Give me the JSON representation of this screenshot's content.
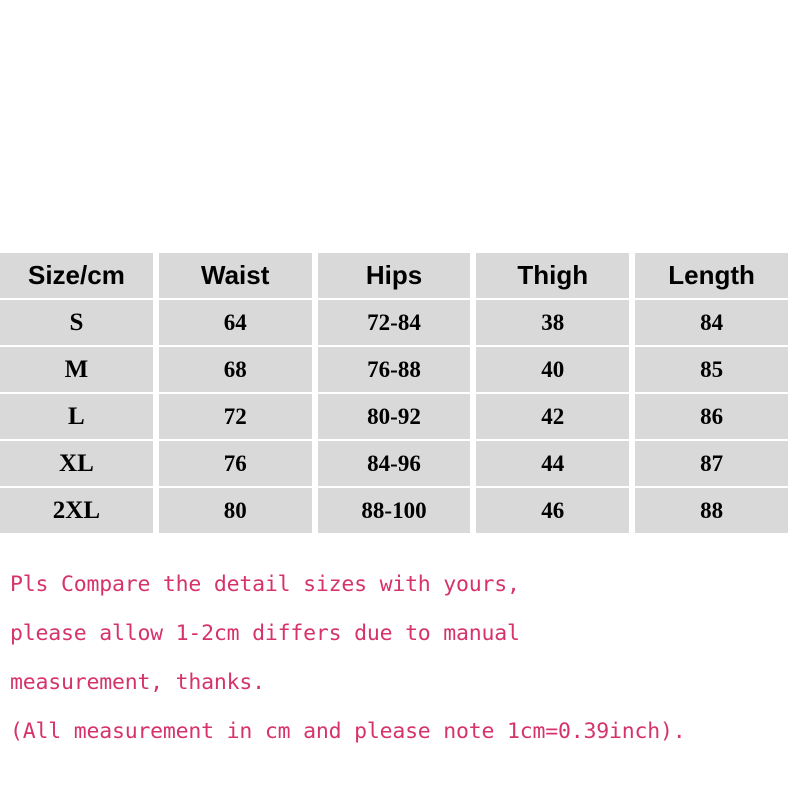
{
  "table": {
    "headers": [
      "Size/cm",
      "Waist",
      "Hips",
      "Thigh",
      "Length"
    ],
    "rows": [
      {
        "size": "S",
        "waist": "64",
        "hips": "72-84",
        "thigh": "38",
        "length": "84"
      },
      {
        "size": "M",
        "waist": "68",
        "hips": "76-88",
        "thigh": "40",
        "length": "85"
      },
      {
        "size": "L",
        "waist": "72",
        "hips": "80-92",
        "thigh": "42",
        "length": "86"
      },
      {
        "size": "XL",
        "waist": "76",
        "hips": "84-96",
        "thigh": "44",
        "length": "87"
      },
      {
        "size": "2XL",
        "waist": "80",
        "hips": "88-100",
        "thigh": "46",
        "length": "88"
      }
    ]
  },
  "notes": {
    "color": "#d6336c",
    "lines": [
      "Pls Compare the detail sizes with yours,",
      "please allow 1-2cm differs due to manual",
      "measurement, thanks.",
      "(All measurement in cm and please note 1cm=0.39inch)."
    ]
  },
  "colors": {
    "cell_background": "#d9d9d9",
    "page_background": "#ffffff",
    "text": "#000000",
    "note_text": "#d6336c"
  }
}
